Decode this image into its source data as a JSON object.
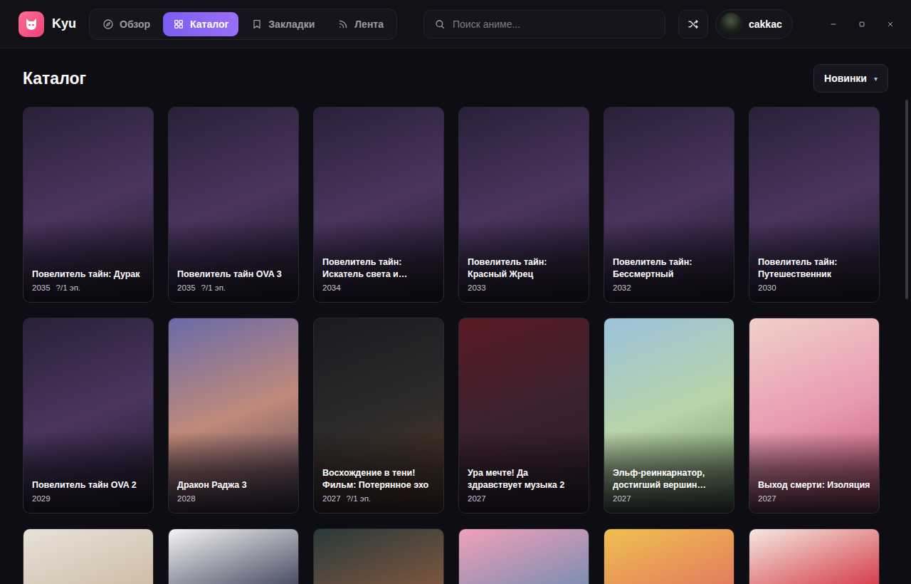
{
  "app": {
    "name": "Kyu"
  },
  "tabs": [
    {
      "label": "Обзор",
      "selected": false
    },
    {
      "label": "Каталог",
      "selected": true
    },
    {
      "label": "Закладки",
      "selected": false
    },
    {
      "label": "Лента",
      "selected": false
    }
  ],
  "search": {
    "placeholder": "Поиск аниме..."
  },
  "user": {
    "name": "cakkac"
  },
  "page": {
    "title": "Каталог",
    "sort": "Новинки",
    "sort_arrow": "▾"
  },
  "cards": [
    {
      "kind": "full",
      "title": "Повелитель тайн: Дурак",
      "year": "2035",
      "episodes": "?/1 эп."
    },
    {
      "kind": "full",
      "title": "Повелитель тайн OVA 3",
      "year": "2035",
      "episodes": "?/1 эп."
    },
    {
      "kind": "full",
      "title": "Повелитель тайн: Искатель света и…",
      "year": "2034"
    },
    {
      "kind": "full",
      "title": "Повелитель тайн: Красный Жрец",
      "year": "2033"
    },
    {
      "kind": "full",
      "title": "Повелитель тайн: Бессмертный",
      "year": "2032"
    },
    {
      "kind": "full",
      "title": "Повелитель тайн: Путешественник",
      "year": "2030"
    },
    {
      "kind": "full",
      "title": "Повелитель тайн OVA 2",
      "year": "2029"
    },
    {
      "kind": "full",
      "title": "Дракон Раджа 3",
      "year": "2028"
    },
    {
      "kind": "full",
      "title": "Восхождение в тени! Фильм: Потерянное эхо",
      "year": "2027",
      "episodes": "?/1 эп."
    },
    {
      "kind": "full",
      "title": "Ура мечте! Да здравствует музыка 2",
      "year": "2027"
    },
    {
      "kind": "full",
      "title": "Эльф-реинкарнатор, достигший вершин…",
      "year": "2027"
    },
    {
      "kind": "full",
      "title": "Выход смерти: Изоляция",
      "year": "2027"
    },
    {
      "kind": "poster"
    },
    {
      "kind": "poster"
    },
    {
      "kind": "poster"
    },
    {
      "kind": "poster"
    },
    {
      "kind": "poster"
    },
    {
      "kind": "poster"
    }
  ]
}
